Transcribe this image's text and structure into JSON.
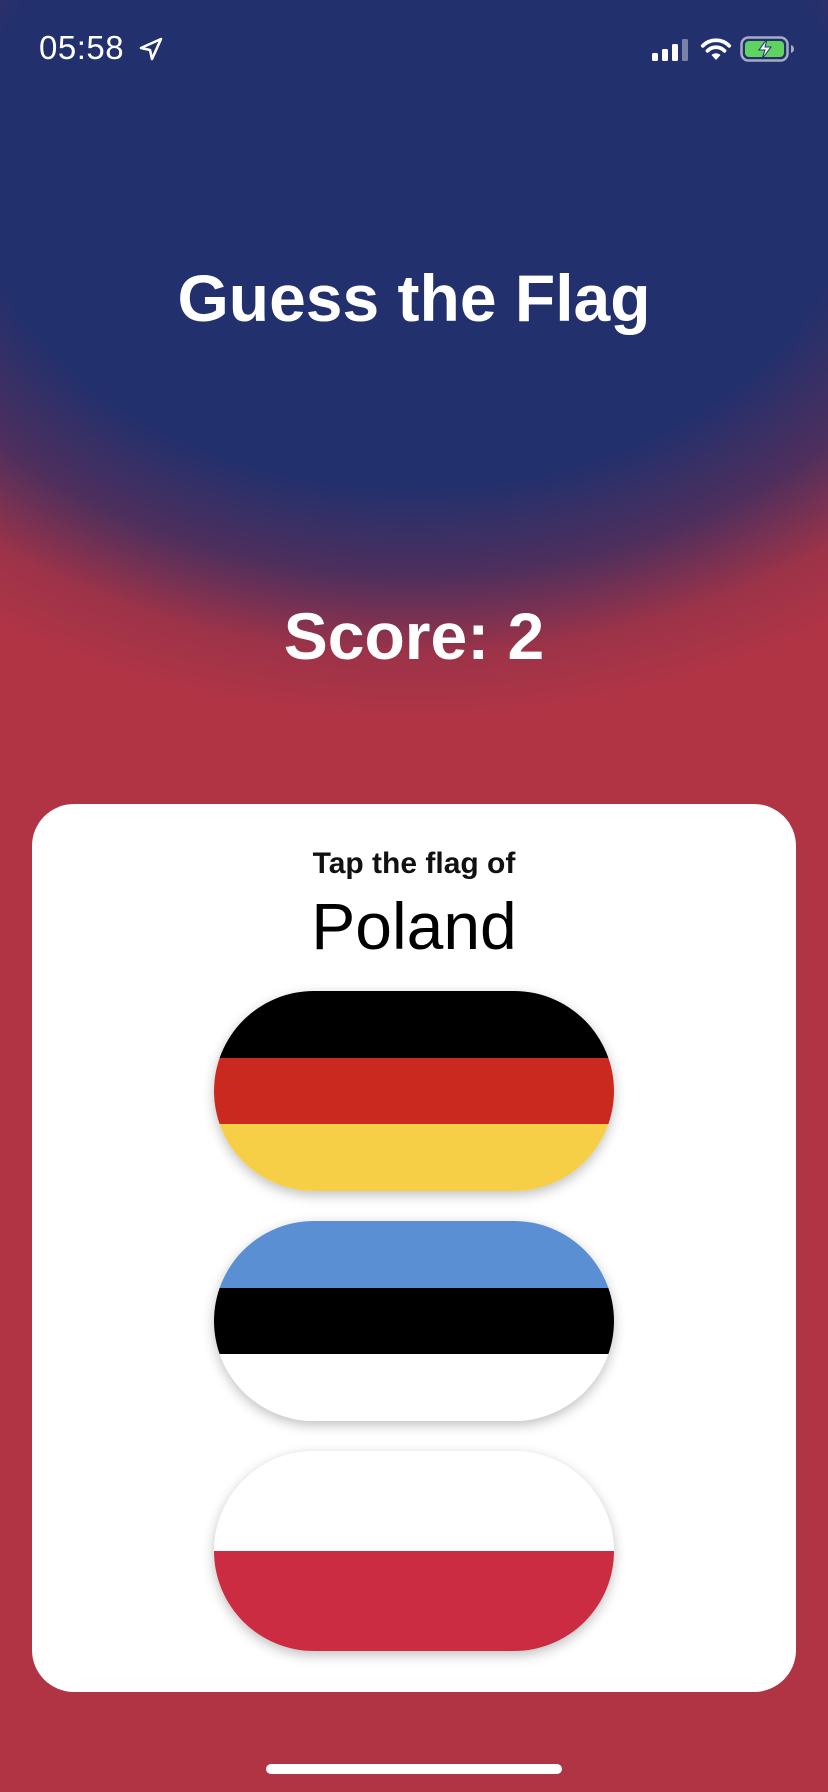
{
  "status_bar": {
    "time": "05:58",
    "icons": [
      "location-arrow-icon",
      "cellular-signal-icon",
      "wifi-icon",
      "battery-charging-icon"
    ]
  },
  "title": "Guess the Flag",
  "score_text": "Score: 2",
  "card": {
    "prompt": "Tap the flag of",
    "country": "Poland",
    "flags": [
      {
        "country": "Germany",
        "stripes": [
          "#000000",
          "#c9291e",
          "#f7cf47"
        ]
      },
      {
        "country": "Estonia",
        "stripes": [
          "#5b8fd3",
          "#000000",
          "#ffffff"
        ]
      },
      {
        "country": "Poland",
        "stripes": [
          "#ffffff",
          "#cb2c41"
        ]
      }
    ]
  },
  "colors": {
    "background_top": "#22306d",
    "background_bottom": "#b13445",
    "card_background": "#ffffff",
    "text_light": "#ffffff",
    "text_dark": "#000000"
  }
}
